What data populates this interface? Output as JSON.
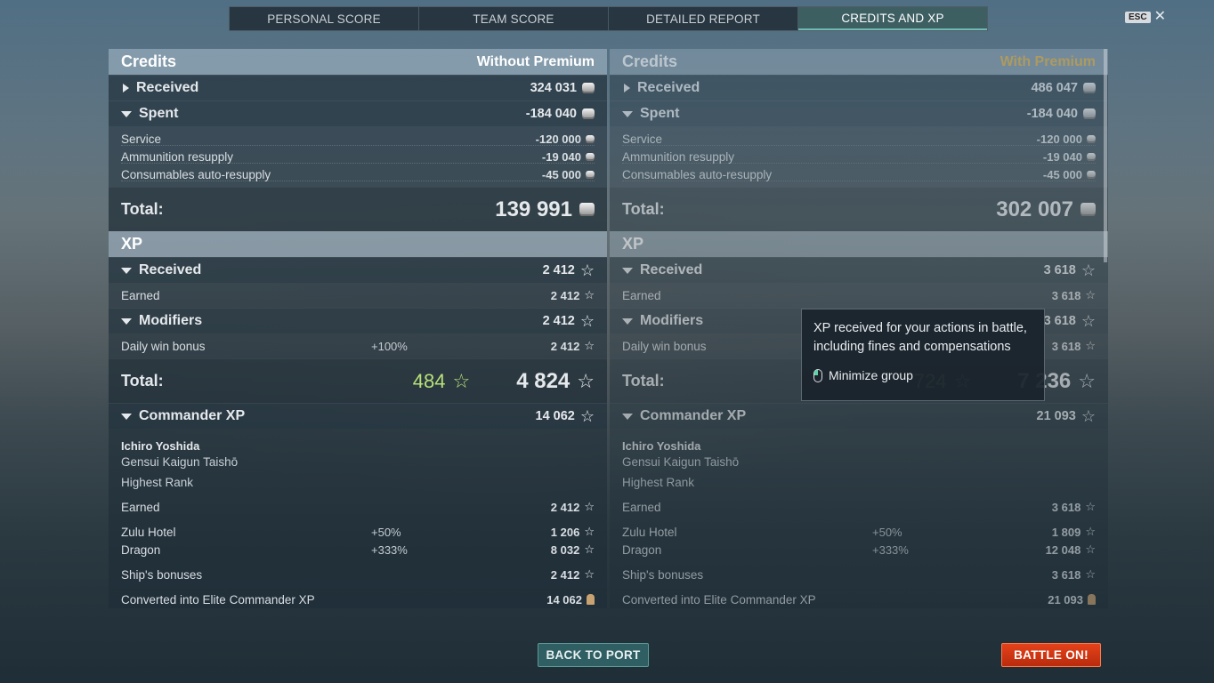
{
  "tabs": [
    {
      "label": "PERSONAL SCORE"
    },
    {
      "label": "TEAM SCORE"
    },
    {
      "label": "DETAILED REPORT"
    },
    {
      "label": "CREDITS AND XP"
    }
  ],
  "esc": {
    "key": "ESC",
    "close": "✕"
  },
  "left": {
    "credits_title": "Credits",
    "credits_sub": "Without Premium",
    "received_label": "Received",
    "received_value": "324 031",
    "spent_label": "Spent",
    "spent_value": "-184 040",
    "spent_rows": [
      {
        "label": "Service",
        "value": "-120 000"
      },
      {
        "label": "Ammunition resupply",
        "value": "-19 040"
      },
      {
        "label": "Consumables auto-resupply",
        "value": "-45 000"
      }
    ],
    "credits_total_label": "Total:",
    "credits_total": "139 991",
    "xp_title": "XP",
    "xp_received_label": "Received",
    "xp_received_value": "2 412",
    "earned_label": "Earned",
    "earned_value": "2 412",
    "modifiers_label": "Modifiers",
    "modifiers_value": "2 412",
    "daily_label": "Daily win bonus",
    "daily_pct": "+100%",
    "daily_value": "2 412",
    "xp_total_label": "Total:",
    "xp_total_green": "484",
    "xp_total": "4 824",
    "commander_label": "Commander XP",
    "commander_value": "14 062",
    "cmd_name": "Ichiro Yoshida",
    "cmd_rank": "Gensui Kaigun Taishō",
    "cmd_highest": "Highest Rank",
    "cmd_rows": [
      {
        "label": "Earned",
        "pct": "",
        "value": "2 412"
      },
      {
        "label": "Zulu Hotel",
        "pct": "+50%",
        "value": "1 206"
      },
      {
        "label": "Dragon",
        "pct": "+333%",
        "value": "8 032"
      }
    ],
    "ship_bonus_label": "Ship's bonuses",
    "ship_bonus_value": "2 412",
    "converted_label": "Converted into Elite Commander XP",
    "converted_value": "14 062"
  },
  "right": {
    "credits_title": "Credits",
    "credits_sub": "With Premium",
    "received_label": "Received",
    "received_value": "486 047",
    "spent_label": "Spent",
    "spent_value": "-184 040",
    "spent_rows": [
      {
        "label": "Service",
        "value": "-120 000"
      },
      {
        "label": "Ammunition resupply",
        "value": "-19 040"
      },
      {
        "label": "Consumables auto-resupply",
        "value": "-45 000"
      }
    ],
    "credits_total_label": "Total:",
    "credits_total": "302 007",
    "xp_title": "XP",
    "xp_received_label": "Received",
    "xp_received_value": "3 618",
    "earned_label": "Earned",
    "earned_value": "3 618",
    "modifiers_label": "Modifiers",
    "modifiers_value": "3 618",
    "daily_label": "Daily win bonus",
    "daily_pct": "",
    "daily_value": "3 618",
    "xp_total_label": "Total:",
    "xp_total_green": "724",
    "xp_total": "7 236",
    "commander_label": "Commander XP",
    "commander_value": "21 093",
    "cmd_name": "Ichiro Yoshida",
    "cmd_rank": "Gensui Kaigun Taishō",
    "cmd_highest": "Highest Rank",
    "cmd_rows": [
      {
        "label": "Earned",
        "pct": "",
        "value": "3 618"
      },
      {
        "label": "Zulu Hotel",
        "pct": "+50%",
        "value": "1 809"
      },
      {
        "label": "Dragon",
        "pct": "+333%",
        "value": "12 048"
      }
    ],
    "ship_bonus_label": "Ship's bonuses",
    "ship_bonus_value": "3 618",
    "converted_label": "Converted into Elite Commander XP",
    "converted_value": "21 093"
  },
  "tooltip": {
    "text": "XP received for your actions in battle, including fines and compensations",
    "hint": "Minimize group"
  },
  "buttons": {
    "back": "BACK TO PORT",
    "battle": "BATTLE ON!"
  },
  "colors": {
    "accent_tab": "#6fb9b0",
    "premium": "#e6b64b",
    "green_xp": "#b8e07a",
    "battle": "#d3380f"
  }
}
